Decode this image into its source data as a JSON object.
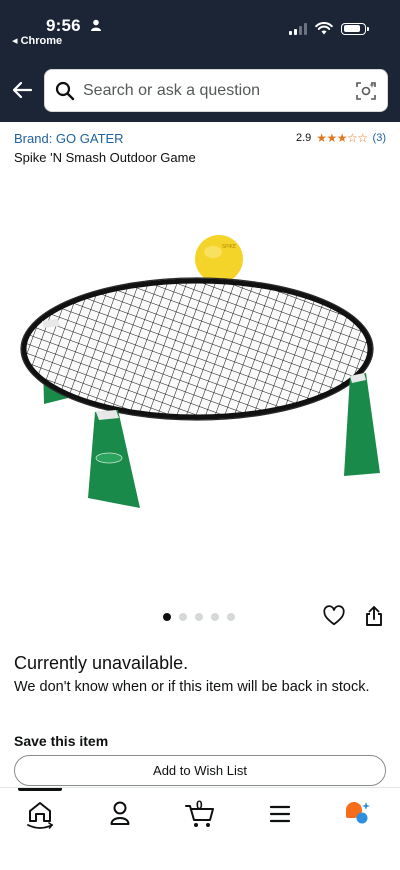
{
  "status_bar": {
    "time": "9:56",
    "back_app": "◂ Chrome"
  },
  "search": {
    "placeholder": "Search or ask a question"
  },
  "product": {
    "brand": "Brand: GO GATER",
    "rating_value": "2.9",
    "stars": "★★★☆☆",
    "rating_count": "(3)",
    "title": "Spike 'N Smash Outdoor Game",
    "image_count": 5,
    "active_image": 1
  },
  "availability": {
    "title": "Currently unavailable.",
    "message": "We don't know when or if this item will be back in stock."
  },
  "save": {
    "title": "Save this item",
    "wishlist_button": "Add to Wish List"
  },
  "cart": {
    "count": "0"
  },
  "colors": {
    "header_bg": "#1c2535",
    "link": "#2162a1",
    "star": "#de7921",
    "net_frame_green": "#1a8a4a",
    "ball_yellow": "#f5d42a"
  },
  "icons": [
    "back-arrow-icon",
    "search-icon",
    "camera-lens-icon",
    "heart-icon",
    "share-icon",
    "home-icon",
    "account-icon",
    "cart-icon",
    "menu-icon",
    "rufus-icon"
  ]
}
